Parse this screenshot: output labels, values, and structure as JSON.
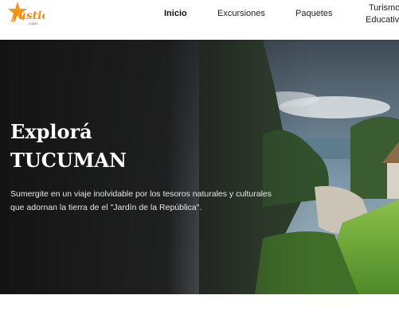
{
  "brand": {
    "logo_text": "Justic",
    "logo_subtext": "viajes"
  },
  "nav": {
    "items": [
      {
        "label": "Inicio",
        "active": true
      },
      {
        "label": "Excursiones"
      },
      {
        "label": "Paquetes"
      }
    ],
    "multiline_item": {
      "line1": "Turismo",
      "line2": "Educativo"
    }
  },
  "hero": {
    "title_line1": "Explorá",
    "title_line2": "TUCUMAN",
    "description": "Sumergite en un viaje inolvidable por los tesoros naturales y culturales que adornan la tierra de el \"Jardín de la República\"."
  },
  "colors": {
    "brand_orange": "#f39a1e",
    "hero_dark": "#141414"
  }
}
